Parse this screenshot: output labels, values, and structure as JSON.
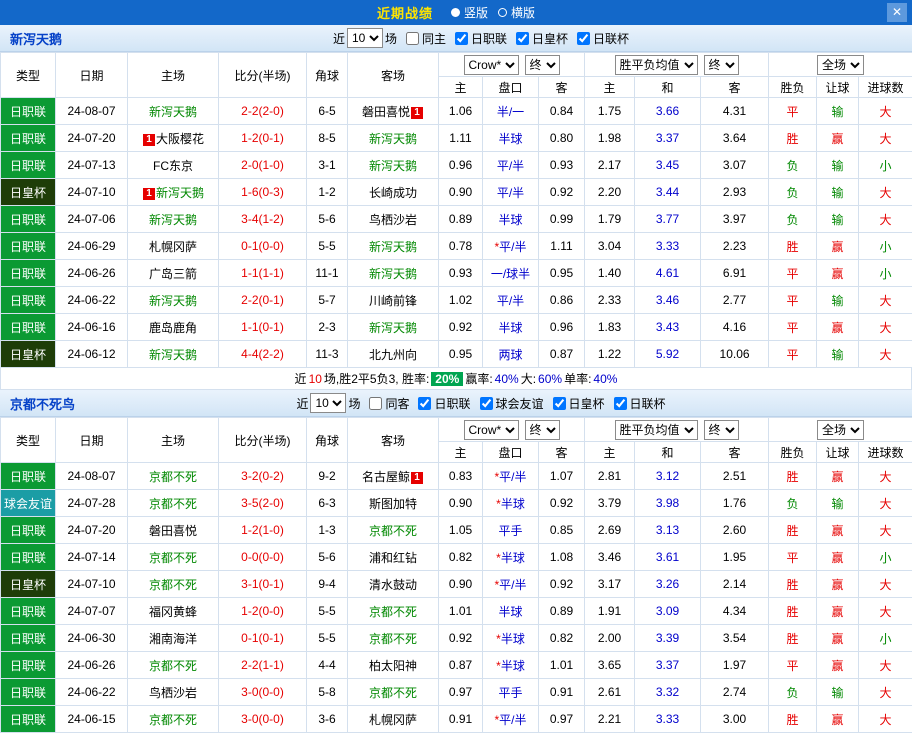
{
  "titlebar": {
    "title": "近期战绩",
    "close_icon": "✕",
    "views": [
      {
        "label": "竖版",
        "selected": true
      },
      {
        "label": "横版",
        "selected": false
      }
    ]
  },
  "columns": [
    "类型",
    "日期",
    "主场",
    "比分(半场)",
    "角球",
    "客场",
    "主",
    "盘口",
    "客",
    "主",
    "和",
    "客",
    "胜负",
    "让球",
    "进球数"
  ],
  "header_controls": {
    "odds_source": "Crow*",
    "odds_stage": "终",
    "avg_source": "胜平负均值",
    "avg_stage": "终",
    "scope": "全场"
  },
  "sections": [
    {
      "team": "新泻天鹅",
      "filter": {
        "prefix": "近",
        "count": "10",
        "suffix": "场",
        "venue": {
          "label": "同主",
          "checked": false
        },
        "leagues": [
          {
            "label": "日职联",
            "checked": true
          },
          {
            "label": "日皇杯",
            "checked": true
          },
          {
            "label": "日联杯",
            "checked": true
          }
        ]
      },
      "rows": [
        {
          "league": "日职联",
          "date": "24-08-07",
          "home": "新泻天鹅",
          "home_focus": true,
          "home_badge": "",
          "away": "磐田喜悦",
          "away_focus": false,
          "away_badge": "1",
          "score": "2-2(2-0)",
          "corner": "6-5",
          "o_home": "1.06",
          "o_line": "半/一",
          "o_star": false,
          "o_away": "0.84",
          "a_home": "1.75",
          "a_draw": "3.66",
          "a_away": "4.31",
          "r_wdl": "平",
          "r_let": "输",
          "r_goal": "大"
        },
        {
          "league": "日职联",
          "date": "24-07-20",
          "home": "大阪樱花",
          "home_focus": false,
          "home_badge": "1",
          "away": "新泻天鹅",
          "away_focus": true,
          "away_badge": "",
          "score": "1-2(0-1)",
          "corner": "8-5",
          "o_home": "1.11",
          "o_line": "半球",
          "o_star": false,
          "o_away": "0.80",
          "a_home": "1.98",
          "a_draw": "3.37",
          "a_away": "3.64",
          "r_wdl": "胜",
          "r_let": "赢",
          "r_goal": "大"
        },
        {
          "league": "日职联",
          "date": "24-07-13",
          "home": "FC东京",
          "home_focus": false,
          "home_badge": "",
          "away": "新泻天鹅",
          "away_focus": true,
          "away_badge": "",
          "score": "2-0(1-0)",
          "corner": "3-1",
          "o_home": "0.96",
          "o_line": "平/半",
          "o_star": false,
          "o_away": "0.93",
          "a_home": "2.17",
          "a_draw": "3.45",
          "a_away": "3.07",
          "r_wdl": "负",
          "r_let": "输",
          "r_goal": "小"
        },
        {
          "league": "日皇杯",
          "date": "24-07-10",
          "home": "新泻天鹅",
          "home_focus": true,
          "home_badge": "1",
          "away": "长崎成功",
          "away_focus": false,
          "away_badge": "",
          "score": "1-6(0-3)",
          "corner": "1-2",
          "o_home": "0.90",
          "o_line": "平/半",
          "o_star": false,
          "o_away": "0.92",
          "a_home": "2.20",
          "a_draw": "3.44",
          "a_away": "2.93",
          "r_wdl": "负",
          "r_let": "输",
          "r_goal": "大"
        },
        {
          "league": "日职联",
          "date": "24-07-06",
          "home": "新泻天鹅",
          "home_focus": true,
          "home_badge": "",
          "away": "鸟栖沙岩",
          "away_focus": false,
          "away_badge": "",
          "score": "3-4(1-2)",
          "corner": "5-6",
          "o_home": "0.89",
          "o_line": "半球",
          "o_star": false,
          "o_away": "0.99",
          "a_home": "1.79",
          "a_draw": "3.77",
          "a_away": "3.97",
          "r_wdl": "负",
          "r_let": "输",
          "r_goal": "大"
        },
        {
          "league": "日职联",
          "date": "24-06-29",
          "home": "札幌冈萨",
          "home_focus": false,
          "home_badge": "",
          "away": "新泻天鹅",
          "away_focus": true,
          "away_badge": "",
          "score": "0-1(0-0)",
          "corner": "5-5",
          "o_home": "0.78",
          "o_line": "平/半",
          "o_star": true,
          "o_away": "1.11",
          "a_home": "3.04",
          "a_draw": "3.33",
          "a_away": "2.23",
          "r_wdl": "胜",
          "r_let": "赢",
          "r_goal": "小"
        },
        {
          "league": "日职联",
          "date": "24-06-26",
          "home": "广岛三箭",
          "home_focus": false,
          "home_badge": "",
          "away": "新泻天鹅",
          "away_focus": true,
          "away_badge": "",
          "score": "1-1(1-1)",
          "corner": "11-1",
          "o_home": "0.93",
          "o_line": "一/球半",
          "o_star": false,
          "o_away": "0.95",
          "a_home": "1.40",
          "a_draw": "4.61",
          "a_away": "6.91",
          "r_wdl": "平",
          "r_let": "赢",
          "r_goal": "小"
        },
        {
          "league": "日职联",
          "date": "24-06-22",
          "home": "新泻天鹅",
          "home_focus": true,
          "home_badge": "",
          "away": "川崎前锋",
          "away_focus": false,
          "away_badge": "",
          "score": "2-2(0-1)",
          "corner": "5-7",
          "o_home": "1.02",
          "o_line": "平/半",
          "o_star": false,
          "o_away": "0.86",
          "a_home": "2.33",
          "a_draw": "3.46",
          "a_away": "2.77",
          "r_wdl": "平",
          "r_let": "输",
          "r_goal": "大"
        },
        {
          "league": "日职联",
          "date": "24-06-16",
          "home": "鹿岛鹿角",
          "home_focus": false,
          "home_badge": "",
          "away": "新泻天鹅",
          "away_focus": true,
          "away_badge": "",
          "score": "1-1(0-1)",
          "corner": "2-3",
          "o_home": "0.92",
          "o_line": "半球",
          "o_star": false,
          "o_away": "0.96",
          "a_home": "1.83",
          "a_draw": "3.43",
          "a_away": "4.16",
          "r_wdl": "平",
          "r_let": "赢",
          "r_goal": "大"
        },
        {
          "league": "日皇杯",
          "date": "24-06-12",
          "home": "新泻天鹅",
          "home_focus": true,
          "home_badge": "",
          "away": "北九州向",
          "away_focus": false,
          "away_badge": "",
          "score": "4-4(2-2)",
          "corner": "11-3",
          "o_home": "0.95",
          "o_line": "两球",
          "o_star": false,
          "o_away": "0.87",
          "a_home": "1.22",
          "a_draw": "5.92",
          "a_away": "10.06",
          "r_wdl": "平",
          "r_let": "输",
          "r_goal": "大"
        }
      ],
      "summary": [
        {
          "text": "近",
          "cls": ""
        },
        {
          "text": "10",
          "cls": "red"
        },
        {
          "text": "场,胜2平5负3, 胜率: ",
          "cls": ""
        },
        {
          "text": "20%",
          "cls": "badge-green"
        },
        {
          "text": " 赢率:",
          "cls": ""
        },
        {
          "text": "40%",
          "cls": "blue"
        },
        {
          "text": " 大:",
          "cls": ""
        },
        {
          "text": "60%",
          "cls": "blue"
        },
        {
          "text": " 单率:",
          "cls": ""
        },
        {
          "text": "40%",
          "cls": "blue"
        }
      ]
    },
    {
      "team": "京都不死鸟",
      "filter": {
        "prefix": "近",
        "count": "10",
        "suffix": "场",
        "venue": {
          "label": "同客",
          "checked": false
        },
        "leagues": [
          {
            "label": "日职联",
            "checked": true
          },
          {
            "label": "球会友谊",
            "checked": true
          },
          {
            "label": "日皇杯",
            "checked": true
          },
          {
            "label": "日联杯",
            "checked": true
          }
        ]
      },
      "rows": [
        {
          "league": "日职联",
          "date": "24-08-07",
          "home": "京都不死",
          "home_focus": true,
          "home_badge": "",
          "away": "名古屋鲸",
          "away_focus": false,
          "away_badge": "1",
          "score": "3-2(0-2)",
          "corner": "9-2",
          "o_home": "0.83",
          "o_line": "平/半",
          "o_star": true,
          "o_away": "1.07",
          "a_home": "2.81",
          "a_draw": "3.12",
          "a_away": "2.51",
          "r_wdl": "胜",
          "r_let": "赢",
          "r_goal": "大"
        },
        {
          "league": "球会友谊",
          "date": "24-07-28",
          "home": "京都不死",
          "home_focus": true,
          "home_badge": "",
          "away": "斯图加特",
          "away_focus": false,
          "away_badge": "",
          "score": "3-5(2-0)",
          "corner": "6-3",
          "o_home": "0.90",
          "o_line": "半球",
          "o_star": true,
          "o_away": "0.92",
          "a_home": "3.79",
          "a_draw": "3.98",
          "a_away": "1.76",
          "r_wdl": "负",
          "r_let": "输",
          "r_goal": "大"
        },
        {
          "league": "日职联",
          "date": "24-07-20",
          "home": "磐田喜悦",
          "home_focus": false,
          "home_badge": "",
          "away": "京都不死",
          "away_focus": true,
          "away_badge": "",
          "score": "1-2(1-0)",
          "corner": "1-3",
          "o_home": "1.05",
          "o_line": "平手",
          "o_star": false,
          "o_away": "0.85",
          "a_home": "2.69",
          "a_draw": "3.13",
          "a_away": "2.60",
          "r_wdl": "胜",
          "r_let": "赢",
          "r_goal": "大"
        },
        {
          "league": "日职联",
          "date": "24-07-14",
          "home": "京都不死",
          "home_focus": true,
          "home_badge": "",
          "away": "浦和红钻",
          "away_focus": false,
          "away_badge": "",
          "score": "0-0(0-0)",
          "corner": "5-6",
          "o_home": "0.82",
          "o_line": "半球",
          "o_star": true,
          "o_away": "1.08",
          "a_home": "3.46",
          "a_draw": "3.61",
          "a_away": "1.95",
          "r_wdl": "平",
          "r_let": "赢",
          "r_goal": "小"
        },
        {
          "league": "日皇杯",
          "date": "24-07-10",
          "home": "京都不死",
          "home_focus": true,
          "home_badge": "",
          "away": "清水鼓动",
          "away_focus": false,
          "away_badge": "",
          "score": "3-1(0-1)",
          "corner": "9-4",
          "o_home": "0.90",
          "o_line": "平/半",
          "o_star": true,
          "o_away": "0.92",
          "a_home": "3.17",
          "a_draw": "3.26",
          "a_away": "2.14",
          "r_wdl": "胜",
          "r_let": "赢",
          "r_goal": "大"
        },
        {
          "league": "日职联",
          "date": "24-07-07",
          "home": "福冈黄蜂",
          "home_focus": false,
          "home_badge": "",
          "away": "京都不死",
          "away_focus": true,
          "away_badge": "",
          "score": "1-2(0-0)",
          "corner": "5-5",
          "o_home": "1.01",
          "o_line": "半球",
          "o_star": false,
          "o_away": "0.89",
          "a_home": "1.91",
          "a_draw": "3.09",
          "a_away": "4.34",
          "r_wdl": "胜",
          "r_let": "赢",
          "r_goal": "大"
        },
        {
          "league": "日职联",
          "date": "24-06-30",
          "home": "湘南海洋",
          "home_focus": false,
          "home_badge": "",
          "away": "京都不死",
          "away_focus": true,
          "away_badge": "",
          "score": "0-1(0-1)",
          "corner": "5-5",
          "o_home": "0.92",
          "o_line": "半球",
          "o_star": true,
          "o_away": "0.82",
          "a_home": "2.00",
          "a_draw": "3.39",
          "a_away": "3.54",
          "r_wdl": "胜",
          "r_let": "赢",
          "r_goal": "小"
        },
        {
          "league": "日职联",
          "date": "24-06-26",
          "home": "京都不死",
          "home_focus": true,
          "home_badge": "",
          "away": "柏太阳神",
          "away_focus": false,
          "away_badge": "",
          "score": "2-2(1-1)",
          "corner": "4-4",
          "o_home": "0.87",
          "o_line": "半球",
          "o_star": true,
          "o_away": "1.01",
          "a_home": "3.65",
          "a_draw": "3.37",
          "a_away": "1.97",
          "r_wdl": "平",
          "r_let": "赢",
          "r_goal": "大"
        },
        {
          "league": "日职联",
          "date": "24-06-22",
          "home": "鸟栖沙岩",
          "home_focus": false,
          "home_badge": "",
          "away": "京都不死",
          "away_focus": true,
          "away_badge": "",
          "score": "3-0(0-0)",
          "corner": "5-8",
          "o_home": "0.97",
          "o_line": "平手",
          "o_star": false,
          "o_away": "0.91",
          "a_home": "2.61",
          "a_draw": "3.32",
          "a_away": "2.74",
          "r_wdl": "负",
          "r_let": "输",
          "r_goal": "大"
        },
        {
          "league": "日职联",
          "date": "24-06-15",
          "home": "京都不死",
          "home_focus": true,
          "home_badge": "",
          "away": "札幌冈萨",
          "away_focus": false,
          "away_badge": "",
          "score": "3-0(0-0)",
          "corner": "3-6",
          "o_home": "0.91",
          "o_line": "平/半",
          "o_star": true,
          "o_away": "0.97",
          "a_home": "2.21",
          "a_draw": "3.33",
          "a_away": "3.00",
          "r_wdl": "胜",
          "r_let": "赢",
          "r_goal": "大"
        }
      ]
    }
  ]
}
